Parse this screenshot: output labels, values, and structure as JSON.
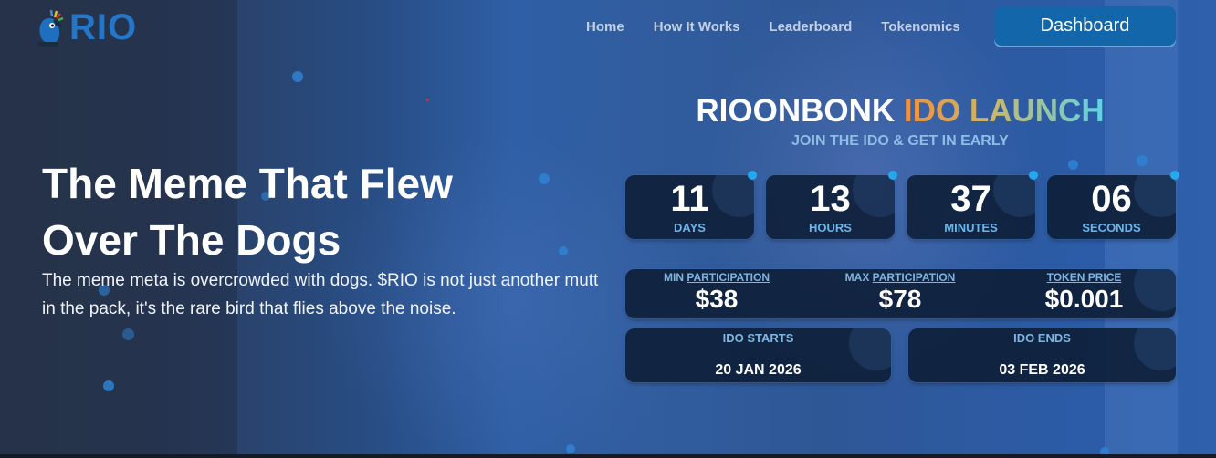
{
  "brand": {
    "name": "RIO"
  },
  "nav": {
    "items": [
      "Home",
      "How It Works",
      "Leaderboard",
      "Tokenomics"
    ],
    "dashboard_label": "Dashboard"
  },
  "hero": {
    "title_line1": "The Meme That Flew",
    "title_line2": "Over The Dogs",
    "description": "The meme meta is overcrowded with dogs. $RIO is not just another mutt in the pack, it's the rare bird that flies above the noise."
  },
  "ido": {
    "title_white": "RIOONBONK",
    "title_gradient": "IDO LAUNCH",
    "subtitle": "JOIN THE IDO & GET IN EARLY",
    "countdown": [
      {
        "value": "11",
        "label": "DAYS"
      },
      {
        "value": "13",
        "label": "HOURS"
      },
      {
        "value": "37",
        "label": "MINUTES"
      },
      {
        "value": "06",
        "label": "SECONDS"
      }
    ],
    "stats": [
      {
        "label_prefix": "MIN ",
        "label_underlined": "PARTICIPATION",
        "value": "$38"
      },
      {
        "label_prefix": "MAX ",
        "label_underlined": "PARTICIPATION",
        "value": "$78"
      },
      {
        "label_prefix": "",
        "label_underlined": "TOKEN PRICE",
        "value": "$0.001"
      }
    ],
    "starts": {
      "label": "IDO STARTS",
      "date": "20 JAN 2026"
    },
    "ends": {
      "label": "IDO ENDS",
      "date": "03 FEB 2026"
    }
  },
  "colors": {
    "accent": "#1266a9",
    "brand_blue": "#2376c8",
    "label_blue": "#69b6ee",
    "gradient_start": "#f0903a",
    "gradient_end": "#5fd3e6"
  },
  "icons": {
    "logo": "parrot-logo-icon"
  }
}
